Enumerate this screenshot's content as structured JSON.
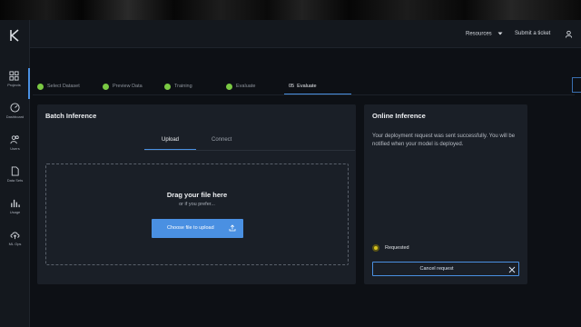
{
  "topbar": {
    "resources_label": "Resources",
    "ticket_label": "Submit a ticket"
  },
  "sidebar": {
    "items": [
      {
        "label": "Projects",
        "icon": "grid-icon"
      },
      {
        "label": "Dashboard",
        "icon": "gauge-icon"
      },
      {
        "label": "Users",
        "icon": "users-icon"
      },
      {
        "label": "Data Sets",
        "icon": "file-icon"
      },
      {
        "label": "Usage",
        "icon": "bar-chart-icon"
      },
      {
        "label": "ML Ops",
        "icon": "cloud-upload-icon"
      }
    ]
  },
  "steps": [
    {
      "label": "Select Dataset",
      "state": "done"
    },
    {
      "label": "Preview Data",
      "state": "done"
    },
    {
      "label": "Training",
      "state": "done"
    },
    {
      "label": "Evaluate",
      "state": "done"
    },
    {
      "label": "05  Evaluate",
      "state": "current"
    }
  ],
  "batch": {
    "title": "Batch Inference",
    "tabs": [
      "Upload",
      "Connect"
    ],
    "drop_title": "Drag your file here",
    "drop_sub": "or if you prefer...",
    "upload_button": "Choose file to upload"
  },
  "online": {
    "title": "Online Inference",
    "message": "Your deployment request was sent successfully. You will be notified when your model is deployed.",
    "status": "Requested",
    "status_color": "#d6c21f",
    "cancel_button": "Cancel request"
  },
  "colors": {
    "accent": "#4a90e2",
    "done": "#7ac943"
  }
}
